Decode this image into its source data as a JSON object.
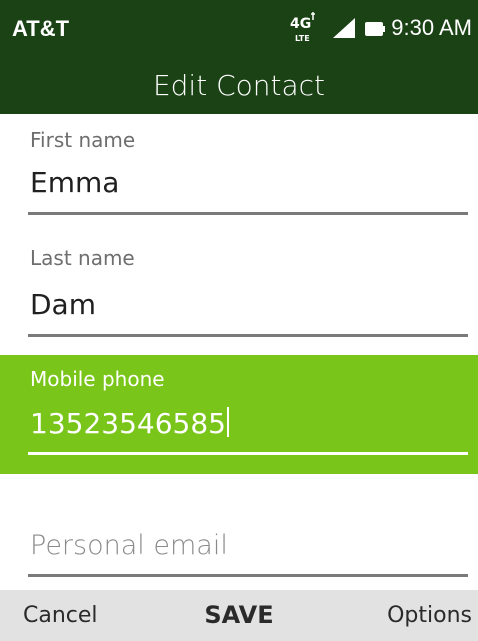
{
  "status_bar": {
    "carrier": "AT&T",
    "network_icon": "4g-lte-icon",
    "signal_icon": "signal-icon",
    "battery_icon": "battery-icon",
    "time": "9:30 AM"
  },
  "header": {
    "title": "Edit Contact"
  },
  "form": {
    "first_name": {
      "label": "First name",
      "value": "Emma"
    },
    "last_name": {
      "label": "Last name",
      "value": "Dam"
    },
    "mobile_phone": {
      "label": "Mobile phone",
      "value": "13523546585"
    },
    "personal_email": {
      "placeholder": "Personal email",
      "value": ""
    }
  },
  "softkeys": {
    "left": "Cancel",
    "center": "SAVE",
    "right": "Options"
  },
  "colors": {
    "header_bg": "#1a4214",
    "focus_bg": "#79c51a",
    "softkey_bg": "#e2e2e2"
  }
}
